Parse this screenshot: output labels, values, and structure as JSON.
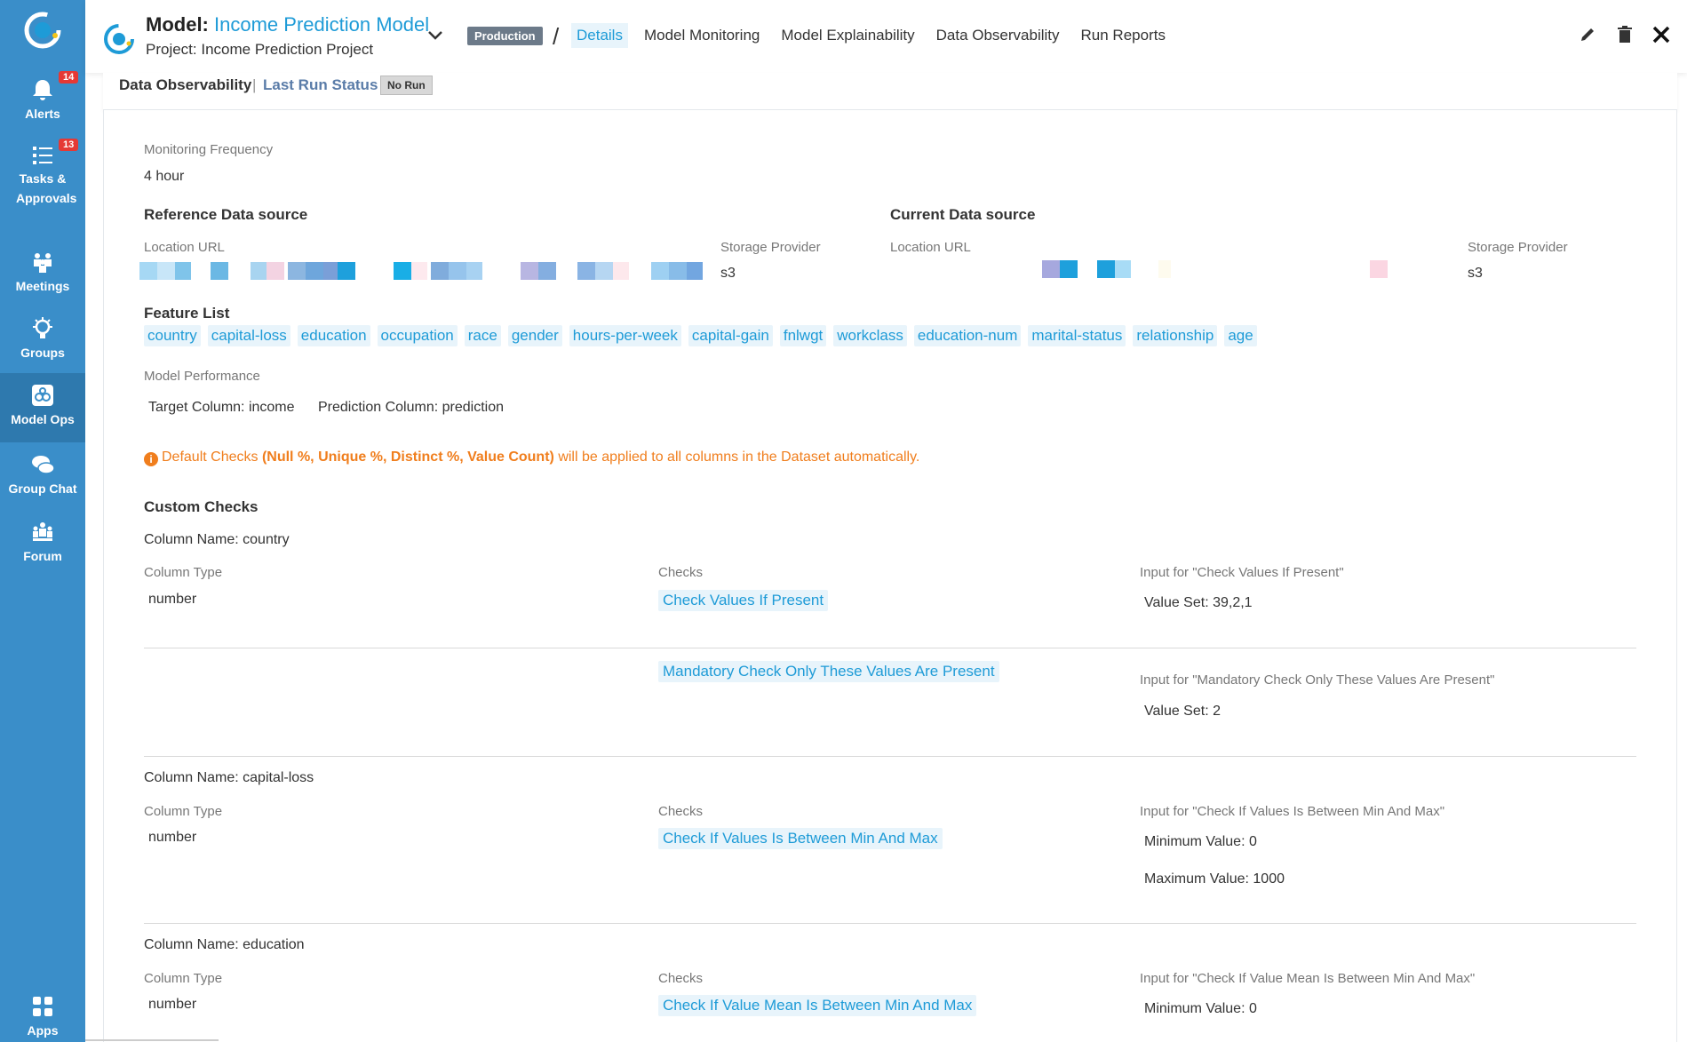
{
  "sidebar": {
    "items": [
      {
        "label": "Alerts",
        "badge": "14"
      },
      {
        "label": "Tasks & Approvals",
        "badge": "13"
      },
      {
        "label": "Meetings"
      },
      {
        "label": "Groups"
      },
      {
        "label": "Model Ops"
      },
      {
        "label": "Group Chat"
      },
      {
        "label": "Forum"
      },
      {
        "label": "Apps"
      }
    ]
  },
  "header": {
    "model_prefix": "Model:",
    "model_name": "Income Prediction Model",
    "project": "Project: Income Prediction Project",
    "status_badge": "Production",
    "separator": "/",
    "tabs": [
      "Details",
      "Model Monitoring",
      "Model Explainability",
      "Data Observability",
      "Run Reports"
    ],
    "active_tab": "Details"
  },
  "subheader": {
    "title": "Data Observability",
    "separator": "|",
    "last_run_label": "Last Run Status :",
    "last_run_value": "No Run"
  },
  "details": {
    "monitoring_frequency_label": "Monitoring Frequency",
    "monitoring_frequency": "4 hour",
    "reference_title": "Reference Data source",
    "current_title": "Current Data source",
    "location_url_label": "Location URL",
    "storage_provider_label": "Storage Provider",
    "reference_storage": "s3",
    "current_storage": "s3",
    "feature_list_title": "Feature List",
    "features": [
      "country",
      "capital-loss",
      "education",
      "occupation",
      "race",
      "gender",
      "hours-per-week",
      "capital-gain",
      "fnlwgt",
      "workclass",
      "education-num",
      "marital-status",
      "relationship",
      "age"
    ],
    "model_performance_label": "Model Performance",
    "target_column": "Target Column: income",
    "prediction_column": "Prediction Column: prediction",
    "notice_prefix": "Default Checks",
    "notice_bold": "(Null %, Unique %, Distinct %, Value Count)",
    "notice_suffix": "will be applied to all columns in the Dataset automatically."
  },
  "custom_checks": {
    "title": "Custom Checks",
    "column_type_label": "Column Type",
    "checks_label": "Checks",
    "columns": [
      {
        "name": "Column Name: country",
        "type": "number",
        "checks": [
          {
            "check": "Check Values If Present",
            "input_label": "Input for \"Check Values If Present\"",
            "inputs": [
              "Value Set: 39,2,1"
            ]
          },
          {
            "check": "Mandatory Check Only These Values Are Present",
            "input_label": "Input for \"Mandatory Check Only These Values Are Present\"",
            "inputs": [
              "Value Set: 2"
            ]
          }
        ]
      },
      {
        "name": "Column Name: capital-loss",
        "type": "number",
        "checks": [
          {
            "check": "Check If Values Is Between Min And Max",
            "input_label": "Input for \"Check If Values Is Between Min And Max\"",
            "inputs": [
              "Minimum Value: 0",
              "Maximum Value: 1000"
            ]
          }
        ]
      },
      {
        "name": "Column Name: education",
        "type": "number",
        "checks": [
          {
            "check": "Check If Value Mean Is Between Min And Max",
            "input_label": "Input for \"Check If Value Mean Is Between Min And Max\"",
            "inputs": [
              "Minimum Value: 0"
            ]
          }
        ]
      }
    ]
  },
  "colors": {
    "sidebar": "#3a8ec9",
    "sidebar_active": "#2e79ae",
    "accent": "#1e9bd7",
    "chip_bg": "#e8f4fb",
    "notice": "#f07e1d",
    "badge": "#e53935"
  }
}
